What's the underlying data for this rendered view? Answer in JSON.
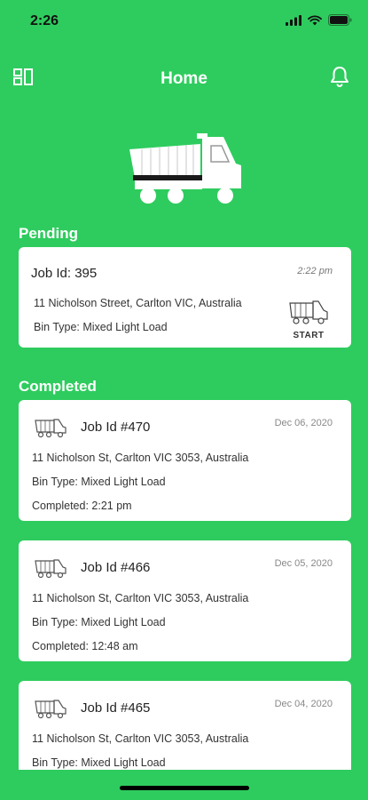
{
  "status_bar": {
    "time": "2:26"
  },
  "header": {
    "title": "Home"
  },
  "pending": {
    "section_title": "Pending",
    "job": {
      "job_id": "Job Id: 395",
      "time": "2:22 pm",
      "address": "11 Nicholson Street, Carlton VIC, Australia",
      "bin_type": "Bin Type: Mixed Light Load",
      "start_label": "START"
    }
  },
  "completed": {
    "section_title": "Completed",
    "jobs": [
      {
        "job_id": "Job Id #470",
        "date": "Dec 06, 2020",
        "address": "11 Nicholson St, Carlton VIC 3053, Australia",
        "bin_type": "Bin Type: Mixed Light Load",
        "completed": "Completed: 2:21 pm"
      },
      {
        "job_id": "Job Id #466",
        "date": "Dec 05, 2020",
        "address": "11 Nicholson St, Carlton VIC 3053, Australia",
        "bin_type": "Bin Type: Mixed Light Load",
        "completed": "Completed: 12:48 am"
      },
      {
        "job_id": "Job Id #465",
        "date": "Dec 04, 2020",
        "address": "11 Nicholson St, Carlton VIC 3053, Australia",
        "bin_type": "Bin Type: Mixed Light Load"
      }
    ]
  },
  "colors": {
    "background": "#2ecc5e",
    "card": "#ffffff"
  },
  "icons": [
    "signal-icon",
    "wifi-icon",
    "battery-icon",
    "menu-icon",
    "bell-icon",
    "truck-icon"
  ]
}
